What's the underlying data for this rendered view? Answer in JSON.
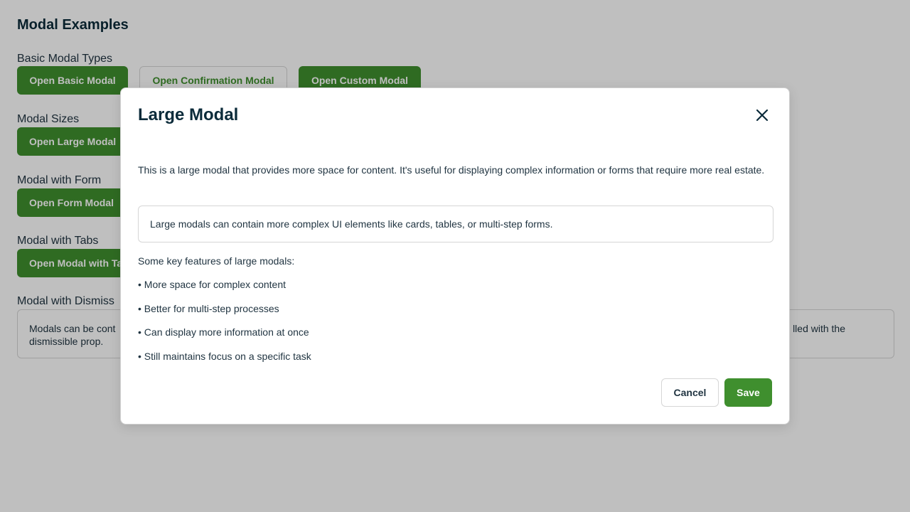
{
  "page": {
    "title": "Modal Examples"
  },
  "sections": {
    "basic": {
      "title": "Basic Modal Types",
      "buttons": [
        "Open Basic Modal",
        "Open Confirmation Modal",
        "Open Custom Modal"
      ]
    },
    "sizes": {
      "title": "Modal Sizes",
      "button": "Open Large Modal"
    },
    "form": {
      "title": "Modal with Form",
      "button": "Open Form Modal"
    },
    "tabs": {
      "title": "Modal with Tabs",
      "button": "Open Modal with Ta"
    },
    "dismissible": {
      "title": "Modal with Dismiss",
      "text_left": "Modals can be cont",
      "text_right": "lled with the",
      "text_line2": "dismissible prop."
    }
  },
  "modal": {
    "title": "Large Modal",
    "close_icon": "close-icon",
    "description": "This is a large modal that provides more space for content. It's useful for displaying complex information or forms that require more real estate.",
    "callout": "Large modals can contain more complex UI elements like cards, tables, or multi-step forms.",
    "features_intro": "Some key features of large modals:",
    "features": [
      "• More space for complex content",
      "• Better for multi-step processes",
      "• Can display more information at once",
      "• Still maintains focus on a specific task"
    ],
    "cancel_label": "Cancel",
    "save_label": "Save"
  },
  "colors": {
    "primary": "#3f8f2e",
    "text_dark": "#0b2b3a",
    "overlay": "rgba(0,0,0,0.25)"
  }
}
